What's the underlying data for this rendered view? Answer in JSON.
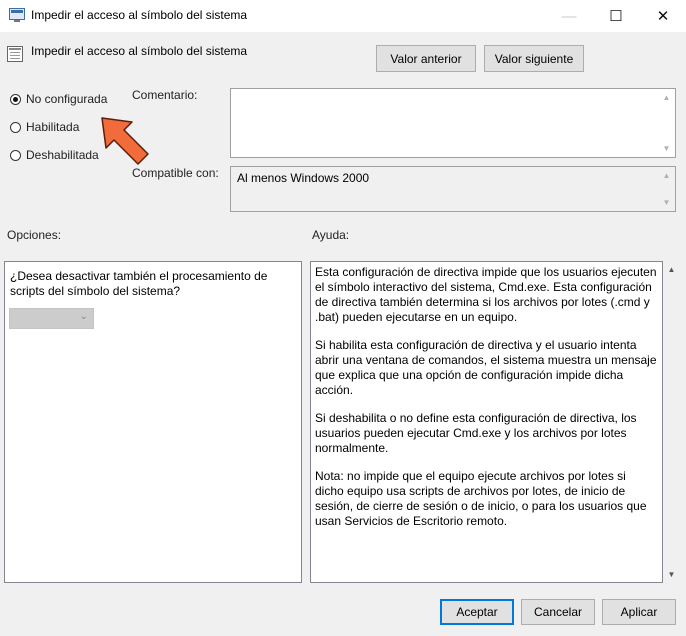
{
  "window": {
    "title": "Impedir el acceso al símbolo del sistema",
    "controls": {
      "minimize": "—",
      "maximize": "☐",
      "close": "✕"
    }
  },
  "policy_name": "Impedir el acceso al símbolo del sistema",
  "nav": {
    "prev_label": "Valor anterior",
    "next_label": "Valor siguiente"
  },
  "state_options": [
    {
      "label": "No configurada",
      "selected": true
    },
    {
      "label": "Habilitada",
      "selected": false
    },
    {
      "label": "Deshabilitada",
      "selected": false
    }
  ],
  "comment": {
    "label": "Comentario:",
    "value": ""
  },
  "compatible": {
    "label": "Compatible con:",
    "value": "Al menos Windows 2000"
  },
  "options": {
    "header": "Opciones:",
    "question": "¿Desea desactivar también el procesamiento de scripts del símbolo del sistema?",
    "dropdown_value": ""
  },
  "help": {
    "header": "Ayuda:",
    "paragraphs": [
      "Esta configuración de directiva impide que los usuarios ejecuten el símbolo interactivo del sistema, Cmd.exe.  Esta configuración de directiva también determina si los archivos por lotes (.cmd y .bat) pueden ejecutarse en un equipo.",
      "Si habilita esta configuración de directiva y el usuario intenta abrir una ventana de comandos, el sistema muestra un mensaje que explica que una opción de configuración impide dicha acción.",
      "Si deshabilita o no define esta configuración de directiva, los usuarios pueden ejecutar Cmd.exe y los archivos por lotes normalmente.",
      "Nota: no impide que el equipo ejecute archivos por lotes si dicho equipo usa scripts de archivos por lotes, de inicio de sesión, de cierre de sesión o de inicio, o para los usuarios que usan Servicios de Escritorio remoto."
    ]
  },
  "footer": {
    "accept_label": "Aceptar",
    "cancel_label": "Cancelar",
    "apply_label": "Aplicar"
  },
  "colors": {
    "accent": "#0078d7",
    "arrow": "#f26b3a"
  }
}
